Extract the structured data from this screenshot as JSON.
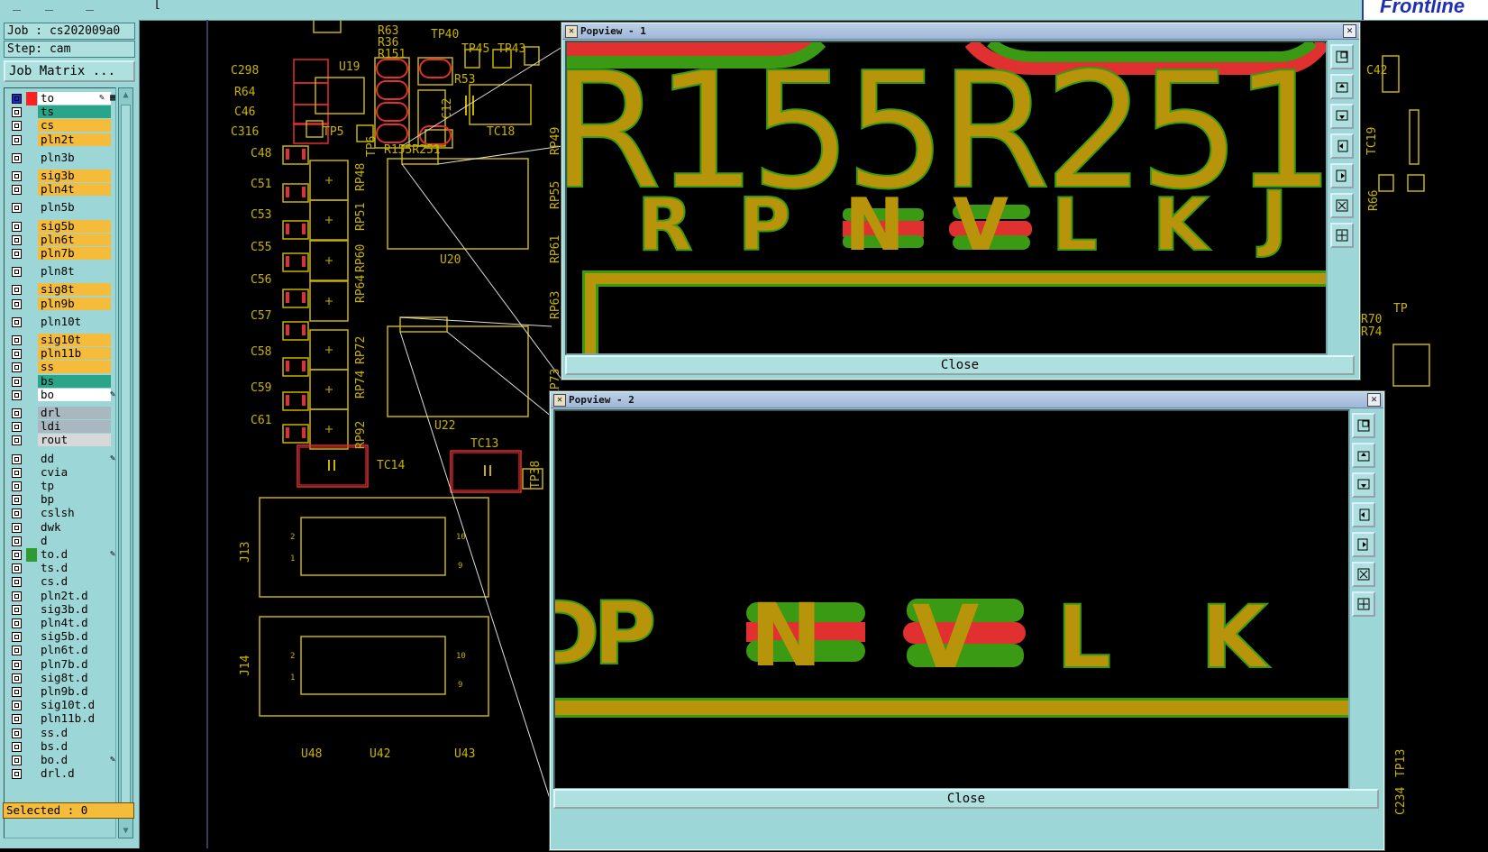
{
  "app": {
    "brand": "Frontline"
  },
  "job": {
    "job_label": "Job : cs202009a0",
    "step_label": "Step: cam",
    "matrix_button": "Job Matrix ..."
  },
  "layers": [
    {
      "name": "to",
      "color": "#ffffff",
      "mark": "✎ ▦",
      "swatch": "#ff2020",
      "active": true
    },
    {
      "name": "ts",
      "color": "#2aa58a"
    },
    {
      "name": "cs",
      "color": "#f5bb3b"
    },
    {
      "name": "pln2t",
      "color": "#f5bb3b"
    },
    {
      "name": "pln3b",
      "color": "#9dd6d6",
      "gap": true
    },
    {
      "name": "sig3b",
      "color": "#f5bb3b",
      "gap": true
    },
    {
      "name": "pln4t",
      "color": "#f5bb3b"
    },
    {
      "name": "pln5b",
      "color": "#9dd6d6",
      "gap": true
    },
    {
      "name": "sig5b",
      "color": "#f5bb3b",
      "gap": true
    },
    {
      "name": "pln6t",
      "color": "#f5bb3b"
    },
    {
      "name": "pln7b",
      "color": "#f5bb3b"
    },
    {
      "name": "pln8t",
      "color": "#9dd6d6",
      "gap": true
    },
    {
      "name": "sig8t",
      "color": "#f5bb3b",
      "gap": true
    },
    {
      "name": "pln9b",
      "color": "#f5bb3b"
    },
    {
      "name": "pln10t",
      "color": "#9dd6d6",
      "gap": true
    },
    {
      "name": "sig10t",
      "color": "#f5bb3b",
      "gap": true
    },
    {
      "name": "pln11b",
      "color": "#f5bb3b"
    },
    {
      "name": "ss",
      "color": "#f5bb3b"
    },
    {
      "name": "bs",
      "color": "#2aa58a"
    },
    {
      "name": "bo",
      "color": "#ffffff",
      "mark": "✎"
    },
    {
      "name": "drl",
      "color": "#a9b8c0",
      "gap": true
    },
    {
      "name": "ldi",
      "color": "#a9b8c0"
    },
    {
      "name": "rout",
      "color": "#d8d8d8"
    },
    {
      "name": "dd",
      "color": "#9dd6d6",
      "mark": "✎",
      "gap": true
    },
    {
      "name": "cvia",
      "color": "#9dd6d6"
    },
    {
      "name": "tp",
      "color": "#9dd6d6"
    },
    {
      "name": "bp",
      "color": "#9dd6d6"
    },
    {
      "name": "cslsh",
      "color": "#9dd6d6"
    },
    {
      "name": "dwk",
      "color": "#9dd6d6"
    },
    {
      "name": "d",
      "color": "#9dd6d6"
    },
    {
      "name": "to.d",
      "color": "#9dd6d6",
      "mark": "✎",
      "swatch": "#2f9a2f"
    },
    {
      "name": "ts.d",
      "color": "#9dd6d6"
    },
    {
      "name": "cs.d",
      "color": "#9dd6d6"
    },
    {
      "name": "pln2t.d",
      "color": "#9dd6d6"
    },
    {
      "name": "sig3b.d",
      "color": "#9dd6d6"
    },
    {
      "name": "pln4t.d",
      "color": "#9dd6d6"
    },
    {
      "name": "sig5b.d",
      "color": "#9dd6d6"
    },
    {
      "name": "pln6t.d",
      "color": "#9dd6d6"
    },
    {
      "name": "pln7b.d",
      "color": "#9dd6d6"
    },
    {
      "name": "sig8t.d",
      "color": "#9dd6d6"
    },
    {
      "name": "pln9b.d",
      "color": "#9dd6d6"
    },
    {
      "name": "sig10t.d",
      "color": "#9dd6d6"
    },
    {
      "name": "pln11b.d",
      "color": "#9dd6d6"
    },
    {
      "name": "ss.d",
      "color": "#9dd6d6"
    },
    {
      "name": "bs.d",
      "color": "#9dd6d6"
    },
    {
      "name": "bo.d",
      "color": "#9dd6d6",
      "mark": "✎"
    },
    {
      "name": "drl.d",
      "color": "#9dd6d6"
    }
  ],
  "status": {
    "selected": "Selected : 0"
  },
  "board": {
    "labels": [
      "TP40",
      "R63",
      "R36",
      "R151",
      "TP45",
      "TP43",
      "U19",
      "R53",
      "C298",
      "R64",
      "C46",
      "C316",
      "TP5",
      "C12",
      "TC18",
      "TP6",
      "R155R251",
      "RP49",
      "C48",
      "RP48",
      "C51",
      "RP51",
      "C53",
      "RP60",
      "C55",
      "RP64",
      "C56",
      "U20",
      "C57",
      "RP72",
      "C58",
      "RP74",
      "C59",
      "RP92",
      "C61",
      "U22",
      "RP73",
      "TC14",
      "TC13",
      "TP38",
      "J13",
      "J14",
      "U48",
      "U42",
      "U43",
      "C42",
      "TC19",
      "R66",
      "R70",
      "R74",
      "TP",
      "C234",
      "TP13"
    ],
    "colors": {
      "silk": "#c8b300",
      "pad": "#e03030",
      "outline": "#c8b300"
    }
  },
  "popview1": {
    "title": "Popview - 1",
    "close": "Close",
    "big_text": "R155R251",
    "small_text": [
      "R",
      "P",
      "N",
      "V",
      "L",
      "K",
      "J"
    ]
  },
  "popview2": {
    "title": "Popview - 2",
    "close": "Close",
    "small_text": [
      "P",
      "N",
      "V",
      "L",
      "K"
    ]
  },
  "toolbar_icons": [
    "zoom-fit-icon",
    "pan-up-icon",
    "pan-down-icon",
    "pan-left-icon",
    "pan-right-icon",
    "zoom-in-icon",
    "zoom-out-icon"
  ]
}
